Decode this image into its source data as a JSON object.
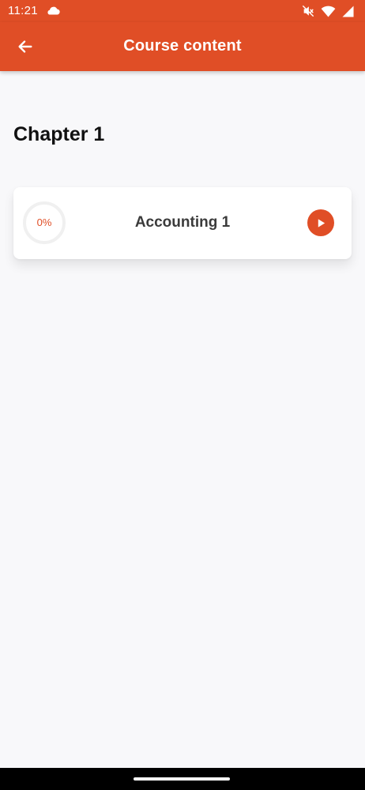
{
  "status_bar": {
    "time": "11:21",
    "icons": [
      "cloud-icon",
      "mute-icon",
      "wifi-icon",
      "signal-icon"
    ]
  },
  "app_bar": {
    "back_icon": "arrow-left-icon",
    "title": "Course content"
  },
  "chapters": [
    {
      "title": "Chapter 1",
      "lessons": [
        {
          "title": "Accounting 1",
          "progress_label": "0%",
          "progress": 0,
          "action_icon": "play-icon"
        }
      ]
    }
  ],
  "colors": {
    "accent": "#e04e26",
    "background": "#f8f8fa",
    "card": "#ffffff",
    "ring_track": "#f0f0f0",
    "heading": "#111111",
    "lesson_text": "#3b3b3b"
  }
}
